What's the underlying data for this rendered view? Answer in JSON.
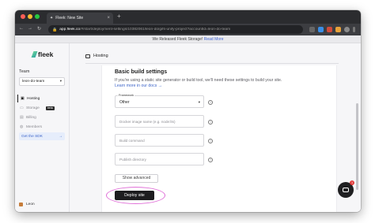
{
  "browser": {
    "tab_title": "Fleek: New Site",
    "tab_icon": "fleek-icon",
    "new_tab_glyph": "+",
    "url_host": "app.fleek.co",
    "url_path": "/#/start/deployment-settings/10382061/leon-do/gifs-unify-project?accountId=leon-do-team"
  },
  "banner": {
    "text": "We Released Fleek Storage!",
    "link": "Read More"
  },
  "sidebar": {
    "logo_text": "fleek",
    "team_label": "Team",
    "team_value": "leon-do-team",
    "items": [
      {
        "label": "Hosting",
        "icon": "hosting-icon",
        "active": true
      },
      {
        "label": "Storage",
        "icon": "storage-icon",
        "badge": "beta"
      },
      {
        "label": "Billing",
        "icon": "billing-icon"
      },
      {
        "label": "Members",
        "icon": "members-icon"
      }
    ],
    "sdk_label": "Get the SDK",
    "sdk_arrow": "→",
    "user_name": "Leon"
  },
  "main": {
    "section_title": "Hosting",
    "heading": "Basic build settings",
    "description": "If you're using a static site generator or build tool, we'll need these settings to build your site.",
    "learn_more": "Learn more in our docs →",
    "framework_label": "Framework",
    "framework_value": "Other",
    "docker_placeholder": "Docker image name (e.g. node:lts)",
    "build_placeholder": "Build command",
    "publish_placeholder": "Publish directory",
    "show_advanced": "Show advanced",
    "deploy": "Deploy site",
    "info_glyph": "i"
  },
  "chat": {
    "badge_count": "1"
  },
  "colors": {
    "accent": "#3f66c9",
    "deploy_ring": "#e070d8",
    "button_dark": "#1d1d1f"
  }
}
